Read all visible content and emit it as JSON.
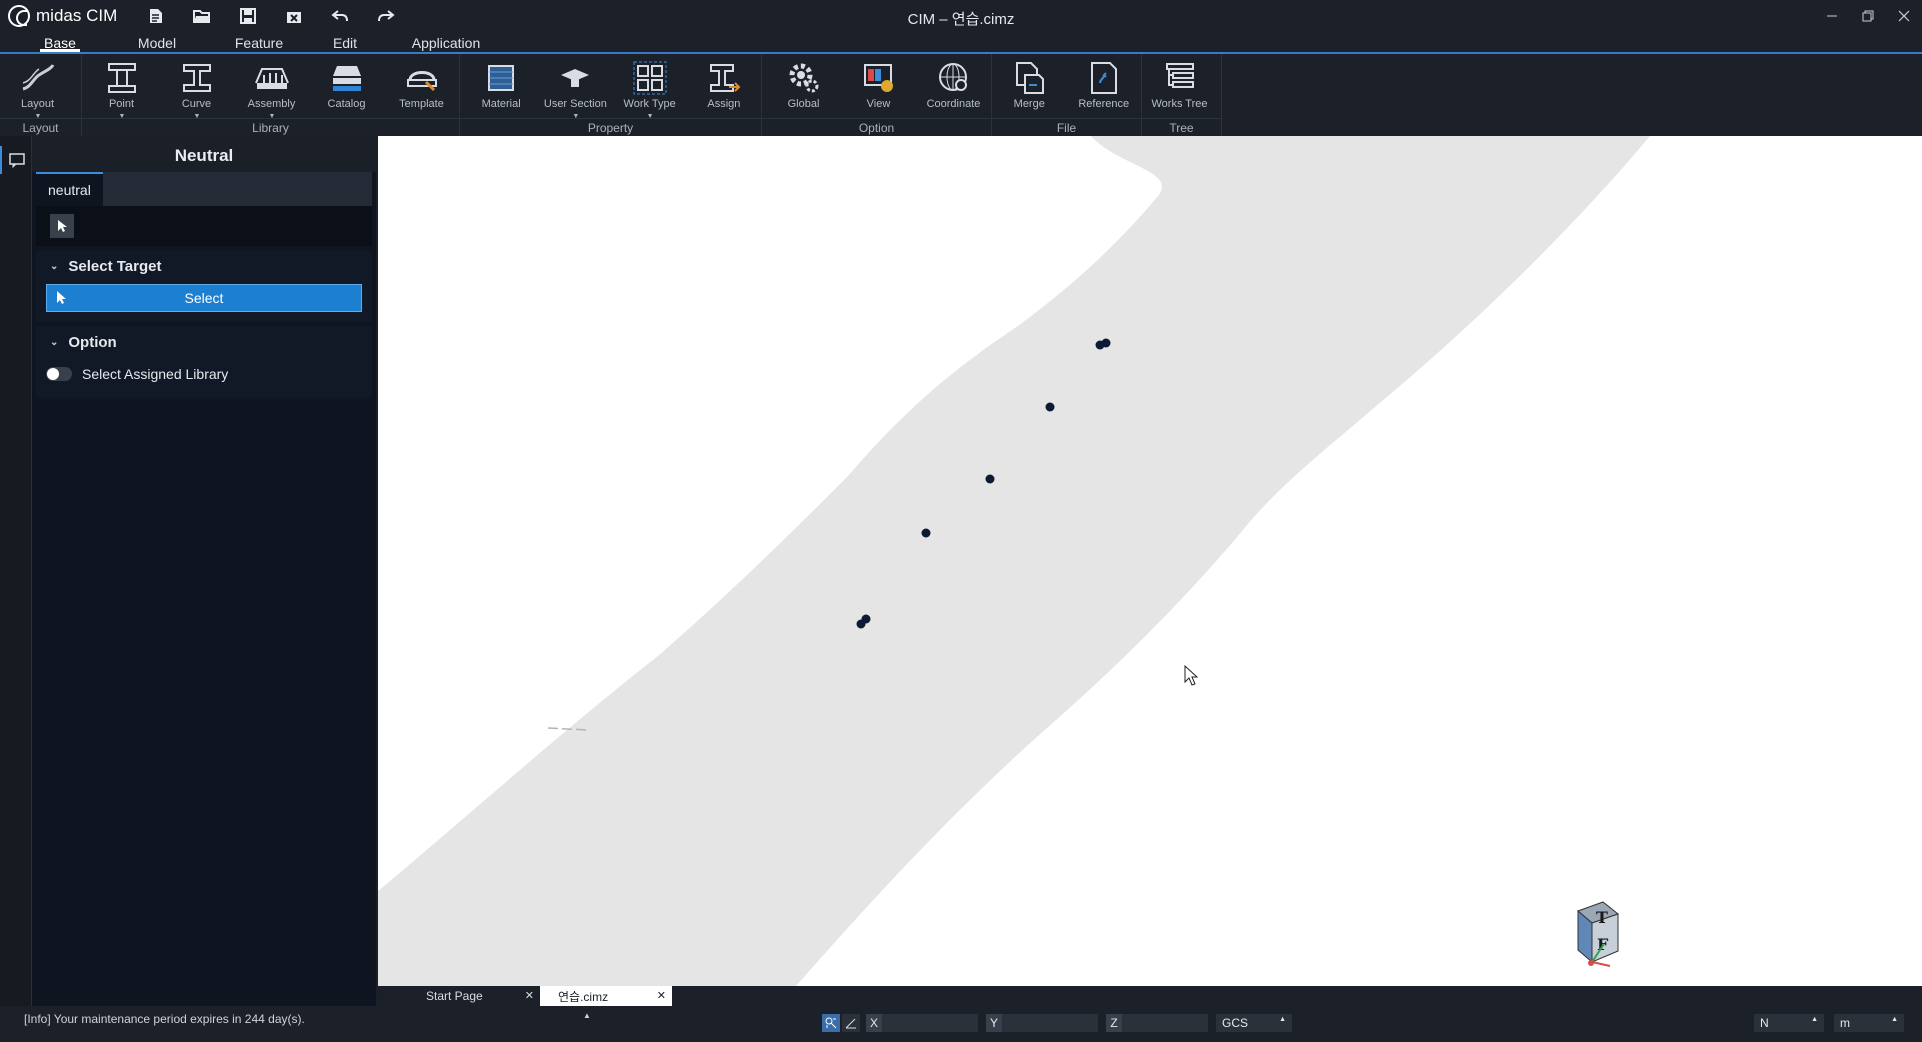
{
  "app": {
    "name": "midas CIM",
    "window_title": "CIM – 연습.cimz"
  },
  "quick_access": [
    "new-file-icon",
    "open-folder-icon",
    "save-icon",
    "close-file-icon",
    "undo-icon",
    "redo-icon"
  ],
  "menu": {
    "tabs": [
      "Base",
      "Model",
      "Feature",
      "Edit",
      "Application"
    ],
    "active": "Base"
  },
  "ribbon": {
    "groups": [
      {
        "label": "Layout",
        "buttons": [
          {
            "label": "Layout",
            "icon": "layout-icon",
            "dropdown": true
          }
        ]
      },
      {
        "label": "Library",
        "buttons": [
          {
            "label": "Point",
            "icon": "point-icon",
            "dropdown": true
          },
          {
            "label": "Curve",
            "icon": "curve-icon",
            "dropdown": true
          },
          {
            "label": "Assembly",
            "icon": "assembly-icon",
            "dropdown": true
          },
          {
            "label": "Catalog",
            "icon": "catalog-icon",
            "dropdown": false
          },
          {
            "label": "Template",
            "icon": "template-icon",
            "dropdown": false
          }
        ]
      },
      {
        "label": "Property",
        "buttons": [
          {
            "label": "Material",
            "icon": "material-icon",
            "dropdown": false
          },
          {
            "label": "User Section",
            "icon": "user-section-icon",
            "dropdown": true
          },
          {
            "label": "Work Type",
            "icon": "work-type-icon",
            "dropdown": true
          },
          {
            "label": "Assign",
            "icon": "assign-icon",
            "dropdown": false
          }
        ]
      },
      {
        "label": "Option",
        "buttons": [
          {
            "label": "Global",
            "icon": "gear-icon",
            "dropdown": false
          },
          {
            "label": "View",
            "icon": "view-icon",
            "dropdown": false
          },
          {
            "label": "Coordinate",
            "icon": "coordinate-icon",
            "dropdown": false
          }
        ]
      },
      {
        "label": "File",
        "buttons": [
          {
            "label": "Merge",
            "icon": "merge-icon",
            "dropdown": false
          },
          {
            "label": "Reference",
            "icon": "reference-icon",
            "dropdown": false
          }
        ]
      },
      {
        "label": "Tree",
        "buttons": [
          {
            "label": "Works Tree",
            "icon": "works-tree-icon",
            "dropdown": false
          }
        ]
      }
    ]
  },
  "panel": {
    "title": "Neutral",
    "tab": "neutral",
    "select_target": {
      "header": "Select Target",
      "button": "Select"
    },
    "option": {
      "header": "Option",
      "toggle_label": "Select Assigned Library",
      "toggle_on": false
    }
  },
  "doc_tabs": [
    {
      "label": "Start Page",
      "active": false
    },
    {
      "label": "연습.cimz",
      "active": true
    }
  ],
  "status": {
    "info": "[Info] Your maintenance period expires in 244 day(s).",
    "coord_labels": [
      "X",
      "Y",
      "Z"
    ],
    "coord_values": [
      "",
      "",
      ""
    ],
    "system": "GCS",
    "force_unit": "N",
    "length_unit": "m"
  },
  "gizmo": {
    "labels": [
      "T",
      "F"
    ]
  },
  "colors": {
    "accent": "#1d7fd0",
    "road": "#e5e5e5",
    "point": "#0c1a33"
  }
}
